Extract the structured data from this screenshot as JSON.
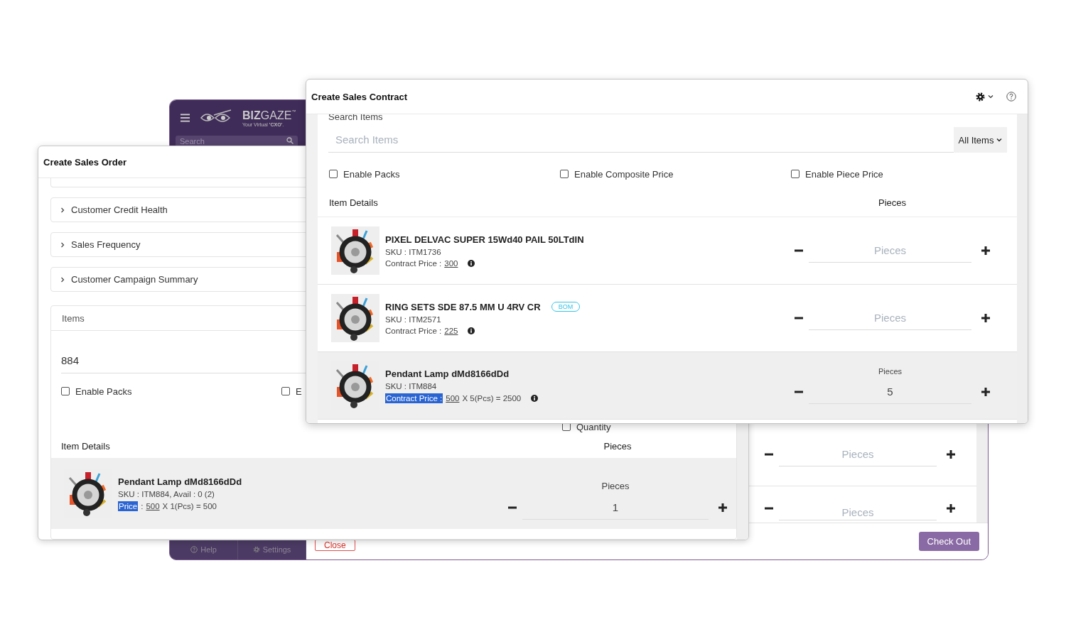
{
  "back_window": {
    "logo": {
      "brand_bold": "BIZ",
      "brand_light": "GAZE",
      "trademark": "™",
      "tagline": "Your Virtual **'CXO'**."
    },
    "search": {
      "placeholder": "Search"
    },
    "item_rows": [
      {
        "placeholder": "Pieces"
      },
      {
        "placeholder": "Pieces"
      }
    ],
    "sidebar_footer": [
      {
        "label": "Help",
        "kind": "help"
      },
      {
        "label": "Settings",
        "kind": "settings"
      }
    ],
    "buttons": [
      {
        "label": "Close",
        "kind": "secondary"
      },
      {
        "label": "Check Out",
        "kind": "primary"
      }
    ]
  },
  "sales_order": {
    "title": "Create Sales Order",
    "sections": [
      {
        "label": "Customer Credit Health",
        "expanded": false
      },
      {
        "label": "Sales Frequency",
        "expanded": false
      },
      {
        "label": "Customer Campaign Summary",
        "expanded": false
      }
    ],
    "items_panel": {
      "title": "Items",
      "search_value": "884",
      "options": [
        {
          "label": "Enable Packs",
          "checked": false
        },
        {
          "label": "E",
          "checked": false
        },
        {
          "label": "Quantity",
          "checked": false
        }
      ],
      "columns": [
        "Item Details",
        "Pieces"
      ],
      "rows": [
        {
          "name": "Pendant Lamp dMd8166dDd",
          "sku": "SKU : ITM884, Avail : 0 (2)",
          "price_label": "Price",
          "label_highlighted": true,
          "price_sep": ":",
          "price": "500",
          "price_suffix": "X 1(Pcs) = 500",
          "quantity_label": "Pieces",
          "quantity_value": "1",
          "selected": true
        }
      ]
    }
  },
  "sales_contract": {
    "title": "Create Sales Contract",
    "search": {
      "label": "Search Items",
      "placeholder": "Search Items",
      "filter": "All Items"
    },
    "options": [
      {
        "label": "Enable Packs",
        "checked": false
      },
      {
        "label": "Enable Composite Price",
        "checked": false
      },
      {
        "label": "Enable Piece Price",
        "checked": false
      }
    ],
    "columns": [
      "Item Details",
      "Pieces"
    ],
    "rows": [
      {
        "name": "PIXEL DELVAC SUPER 15Wd40 PAIL 50LTdIN",
        "sku": "SKU : ITM1736",
        "price_label": "Contract Price :",
        "label_highlighted": false,
        "price": "300",
        "quantity_placeholder": "Pieces",
        "selected": false,
        "info": true
      },
      {
        "name": "RING SETS SDE 87.5 MM U 4RV CR",
        "badge": "BOM",
        "sku": "SKU : ITM2571",
        "price_label": "Contract Price :",
        "label_highlighted": false,
        "price": "225",
        "quantity_placeholder": "Pieces",
        "selected": false,
        "info": true
      },
      {
        "name": "Pendant Lamp dMd8166dDd",
        "sku": "SKU : ITM884",
        "price_label": "Contract Price :",
        "label_highlighted": true,
        "price": "500",
        "price_suffix": "X 5(Pcs) = 2500",
        "quantity_label": "Pieces",
        "quantity_value": "5",
        "selected": true,
        "info": true
      }
    ]
  }
}
